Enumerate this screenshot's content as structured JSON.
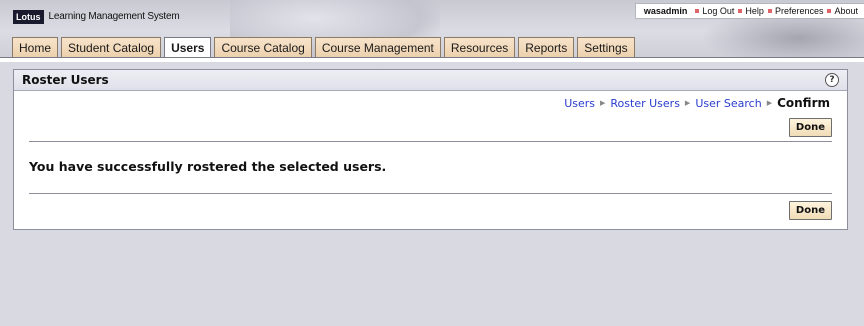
{
  "header": {
    "logo": "Lotus",
    "app_title": "Learning Management System",
    "user": "wasadmin",
    "links": [
      "Log Out",
      "Help",
      "Preferences",
      "About"
    ]
  },
  "tabs": [
    {
      "label": "Home",
      "active": false
    },
    {
      "label": "Student Catalog",
      "active": false
    },
    {
      "label": "Users",
      "active": true
    },
    {
      "label": "Course Catalog",
      "active": false
    },
    {
      "label": "Course Management",
      "active": false
    },
    {
      "label": "Resources",
      "active": false
    },
    {
      "label": "Reports",
      "active": false
    },
    {
      "label": "Settings",
      "active": false
    }
  ],
  "panel": {
    "title": "Roster Users",
    "help_icon": "help-icon",
    "breadcrumb": [
      "Users",
      "Roster Users",
      "User Search"
    ],
    "breadcrumb_current": "Confirm",
    "message": "You have successfully rostered the selected users.",
    "done_label": "Done"
  },
  "colors": {
    "tab_bg": "#f7e4cb",
    "link": "#2a3ecf",
    "page_bg": "#d9d9e2"
  }
}
